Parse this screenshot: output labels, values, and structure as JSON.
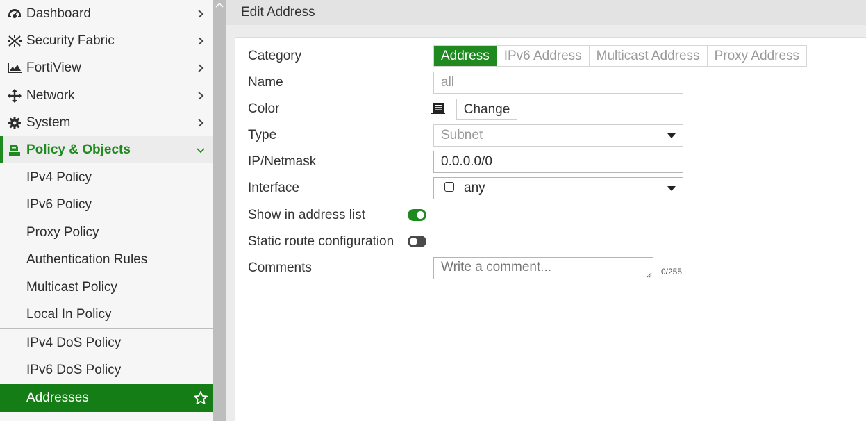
{
  "sidebar": {
    "items": [
      {
        "label": "Dashboard",
        "icon": "dashboard-icon"
      },
      {
        "label": "Security Fabric",
        "icon": "security-fabric-icon"
      },
      {
        "label": "FortiView",
        "icon": "fortiview-icon"
      },
      {
        "label": "Network",
        "icon": "network-icon"
      },
      {
        "label": "System",
        "icon": "gear-icon"
      },
      {
        "label": "Policy & Objects",
        "icon": "policy-objects-icon"
      }
    ],
    "subitems": [
      "IPv4 Policy",
      "IPv6 Policy",
      "Proxy Policy",
      "Authentication Rules",
      "Multicast Policy",
      "Local In Policy",
      "IPv4 DoS Policy",
      "IPv6 DoS Policy",
      "Addresses"
    ]
  },
  "header": {
    "title": "Edit Address"
  },
  "form": {
    "category": {
      "label": "Category",
      "options": [
        "Address",
        "IPv6 Address",
        "Multicast Address",
        "Proxy Address"
      ],
      "selected": "Address"
    },
    "name": {
      "label": "Name",
      "value": "all"
    },
    "color": {
      "label": "Color",
      "button": "Change"
    },
    "type": {
      "label": "Type",
      "value": "Subnet"
    },
    "ip_netmask": {
      "label": "IP/Netmask",
      "value": "0.0.0.0/0"
    },
    "interface": {
      "label": "Interface",
      "value": "any"
    },
    "show_in_list": {
      "label": "Show in address list",
      "on": true
    },
    "static_route": {
      "label": "Static route configuration",
      "on": false
    },
    "comments": {
      "label": "Comments",
      "placeholder": "Write a comment...",
      "counter": "0/255"
    }
  },
  "colors": {
    "accent": "#1f8a1f",
    "selected_bg": "#157d15"
  }
}
